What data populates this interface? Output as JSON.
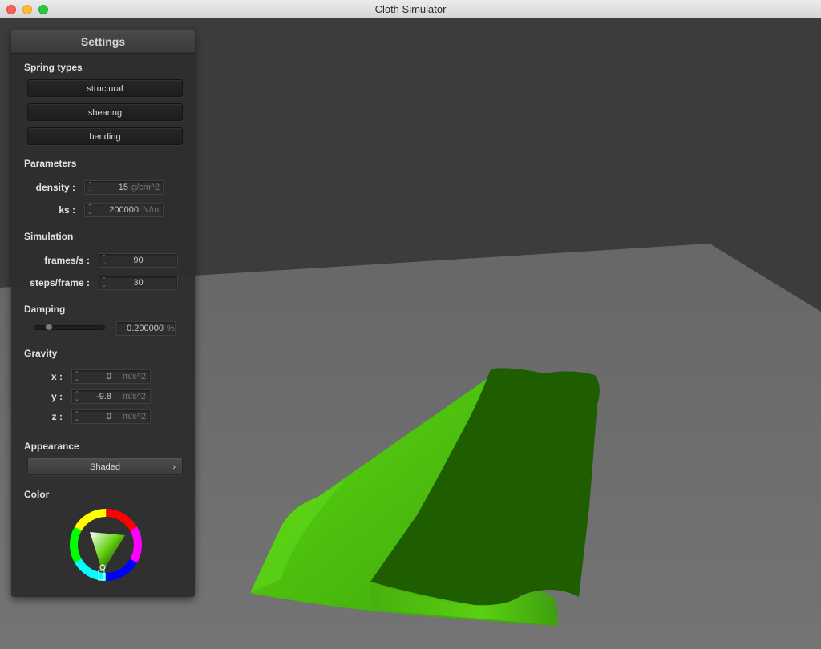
{
  "window": {
    "title": "Cloth Simulator"
  },
  "panel": {
    "title": "Settings",
    "spring_types": {
      "title": "Spring types",
      "buttons": [
        "structural",
        "shearing",
        "bending"
      ]
    },
    "parameters": {
      "title": "Parameters",
      "density": {
        "label": "density :",
        "value": "15",
        "unit": "g/cm^2"
      },
      "ks": {
        "label": "ks :",
        "value": "200000",
        "unit": "N/m"
      }
    },
    "simulation": {
      "title": "Simulation",
      "fps": {
        "label": "frames/s :",
        "value": "90"
      },
      "steps": {
        "label": "steps/frame :",
        "value": "30"
      }
    },
    "damping": {
      "title": "Damping",
      "value": "0.200000",
      "unit": "%",
      "slider_fraction": 0.2
    },
    "gravity": {
      "title": "Gravity",
      "x": {
        "label": "x :",
        "value": "0",
        "unit": "m/s^2"
      },
      "y": {
        "label": "y :",
        "value": "-9.8",
        "unit": "m/s^2"
      },
      "z": {
        "label": "z :",
        "value": "0",
        "unit": "m/s^2"
      }
    },
    "appearance": {
      "title": "Appearance",
      "selected": "Shaded"
    },
    "color": {
      "title": "Color",
      "selected_hex": "#62d10f"
    }
  },
  "scene": {
    "cloth_color_light": "#4fc50f",
    "cloth_color_dark": "#1f5e00",
    "floor_color": "#6f6f6f",
    "background_color": "#3c3c3c"
  }
}
